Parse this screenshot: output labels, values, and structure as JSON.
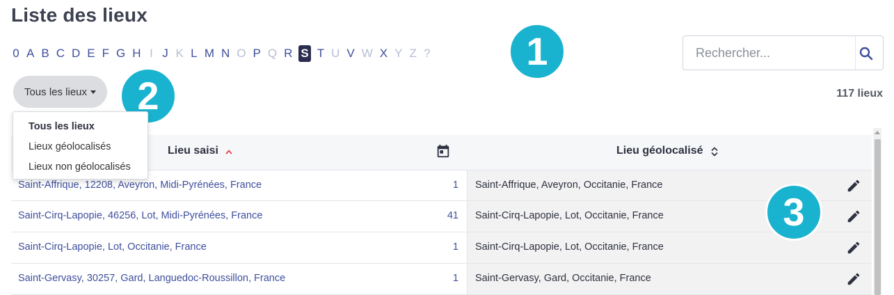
{
  "page": {
    "title": "Liste des lieux"
  },
  "alphabet": {
    "letters": [
      {
        "char": "0",
        "enabled": true
      },
      {
        "char": "A",
        "enabled": true
      },
      {
        "char": "B",
        "enabled": true
      },
      {
        "char": "C",
        "enabled": true
      },
      {
        "char": "D",
        "enabled": true
      },
      {
        "char": "E",
        "enabled": true
      },
      {
        "char": "F",
        "enabled": true
      },
      {
        "char": "G",
        "enabled": true
      },
      {
        "char": "H",
        "enabled": true
      },
      {
        "char": "I",
        "enabled": false
      },
      {
        "char": "J",
        "enabled": true
      },
      {
        "char": "K",
        "enabled": false
      },
      {
        "char": "L",
        "enabled": true
      },
      {
        "char": "M",
        "enabled": true
      },
      {
        "char": "N",
        "enabled": true
      },
      {
        "char": "O",
        "enabled": false
      },
      {
        "char": "P",
        "enabled": true
      },
      {
        "char": "Q",
        "enabled": false
      },
      {
        "char": "R",
        "enabled": true
      },
      {
        "char": "S",
        "enabled": true,
        "active": true
      },
      {
        "char": "T",
        "enabled": true
      },
      {
        "char": "U",
        "enabled": false
      },
      {
        "char": "V",
        "enabled": true
      },
      {
        "char": "W",
        "enabled": false
      },
      {
        "char": "X",
        "enabled": true
      },
      {
        "char": "Y",
        "enabled": false
      },
      {
        "char": "Z",
        "enabled": false
      },
      {
        "char": "?",
        "enabled": false
      }
    ]
  },
  "badges": {
    "one": "1",
    "two": "2",
    "three": "3"
  },
  "search": {
    "placeholder": "Rechercher...",
    "value": ""
  },
  "filter": {
    "label": "Tous les lieux",
    "options": [
      "Tous les lieux",
      "Lieux géolocalisés",
      "Lieux non géolocalisés"
    ],
    "selected_index": 0
  },
  "count": "117 lieux",
  "table": {
    "col_lieu": "Lieu saisi",
    "col_geo": "Lieu géolocalisé",
    "rows": [
      {
        "lieu": "Saint-Affrique, 12208, Aveyron, Midi-Pyrénées, France",
        "count": "1",
        "geo": "Saint-Affrique, Aveyron, Occitanie, France"
      },
      {
        "lieu": "Saint-Cirq-Lapopie, 46256, Lot, Midi-Pyrénées, France",
        "count": "41",
        "geo": "Saint-Cirq-Lapopie, Lot, Occitanie, France"
      },
      {
        "lieu": "Saint-Cirq-Lapopie, Lot, Occitanie, France",
        "count": "1",
        "geo": "Saint-Cirq-Lapopie, Lot, Occitanie, France"
      },
      {
        "lieu": "Saint-Gervasy, 30257, Gard, Languedoc-Roussillon, France",
        "count": "1",
        "geo": "Saint-Gervasy, Gard, Occitanie, France"
      }
    ]
  },
  "colors": {
    "link": "#3e4e9c",
    "active_letter_bg": "#2a2d4e",
    "disabled_letter": "#b7bed2",
    "badge": "#1ab3cf",
    "sort_accent": "#e0484f"
  },
  "icons": {
    "search": "search-icon",
    "sort_up": "sort-up-icon",
    "calendar": "calendar-icon",
    "sort_both": "sort-both-icon",
    "edit": "pencil-icon"
  }
}
